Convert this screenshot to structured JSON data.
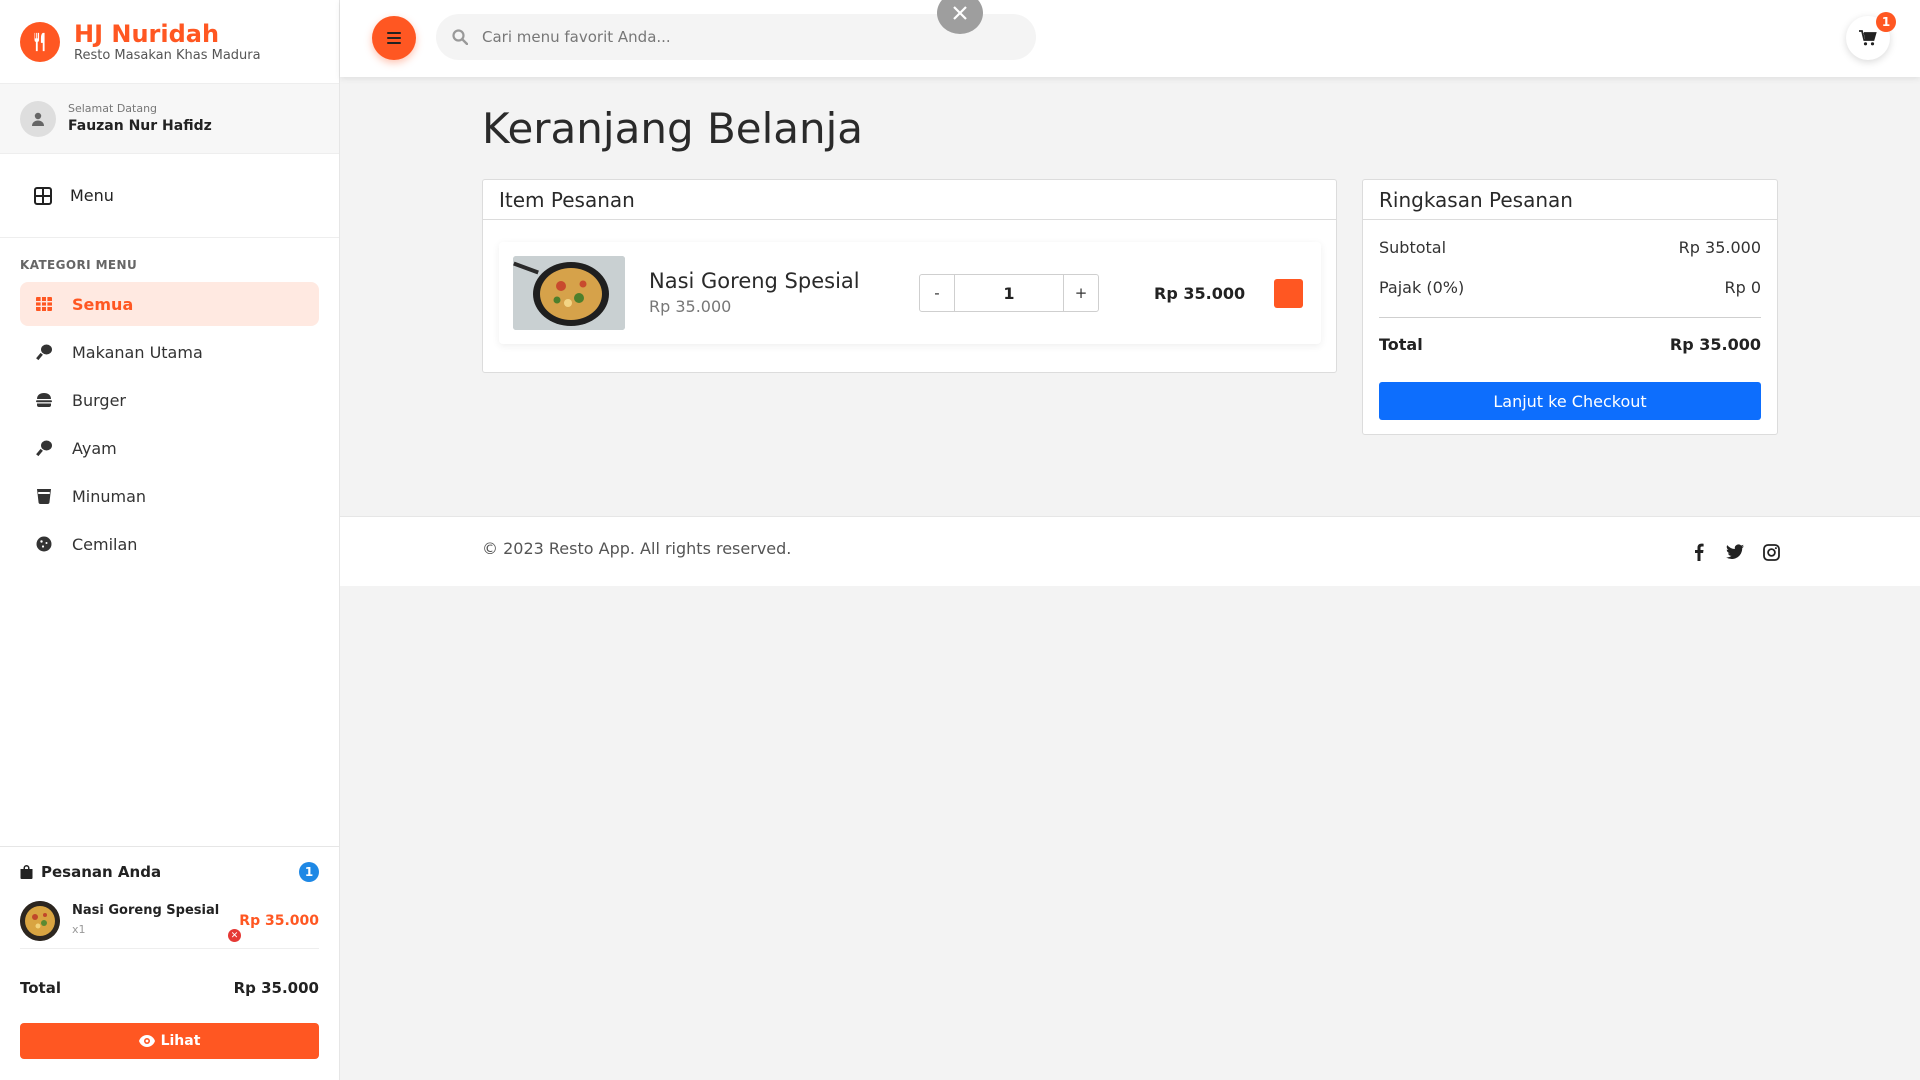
{
  "brand": {
    "title": "HJ Nuridah",
    "subtitle": "Resto Masakan Khas Madura",
    "color": "#ff5722"
  },
  "user": {
    "greeting": "Selamat Datang",
    "name": "Fauzan Nur Hafidz"
  },
  "nav": {
    "menu_label": "Menu"
  },
  "categories": {
    "title": "KATEGORI MENU",
    "items": [
      {
        "label": "Semua",
        "icon": "grid-icon",
        "active": true
      },
      {
        "label": "Makanan Utama",
        "icon": "drumstick-icon"
      },
      {
        "label": "Burger",
        "icon": "burger-icon"
      },
      {
        "label": "Ayam",
        "icon": "drumstick-icon"
      },
      {
        "label": "Minuman",
        "icon": "cup-icon"
      },
      {
        "label": "Cemilan",
        "icon": "cookie-icon"
      }
    ]
  },
  "order_panel": {
    "title": "Pesanan Anda",
    "count": "1",
    "item": {
      "name": "Nasi Goreng Spesial",
      "qty": "x1",
      "price": "Rp 35.000"
    },
    "total_label": "Total",
    "total_value": "Rp 35.000",
    "view_button": "Lihat"
  },
  "search": {
    "placeholder": "Cari menu favorit Anda..."
  },
  "cart": {
    "count": "1"
  },
  "page": {
    "title": "Keranjang Belanja"
  },
  "items_card": {
    "title": "Item Pesanan",
    "item": {
      "name": "Nasi Goreng Spesial",
      "unit_price": "Rp 35.000",
      "qty_minus": "-",
      "qty": "1",
      "qty_plus": "+",
      "total": "Rp 35.000"
    }
  },
  "summary": {
    "title": "Ringkasan Pesanan",
    "subtotal_label": "Subtotal",
    "subtotal_value": "Rp 35.000",
    "tax_label": "Pajak (0%)",
    "tax_value": "Rp 0",
    "total_label": "Total",
    "total_value": "Rp 35.000",
    "checkout_button": "Lanjut ke Checkout",
    "checkout_color": "#0d6efd"
  },
  "footer": {
    "copyright": "© 2023 Resto App. All rights reserved.",
    "social": [
      "facebook-icon",
      "twitter-icon",
      "instagram-icon"
    ]
  }
}
